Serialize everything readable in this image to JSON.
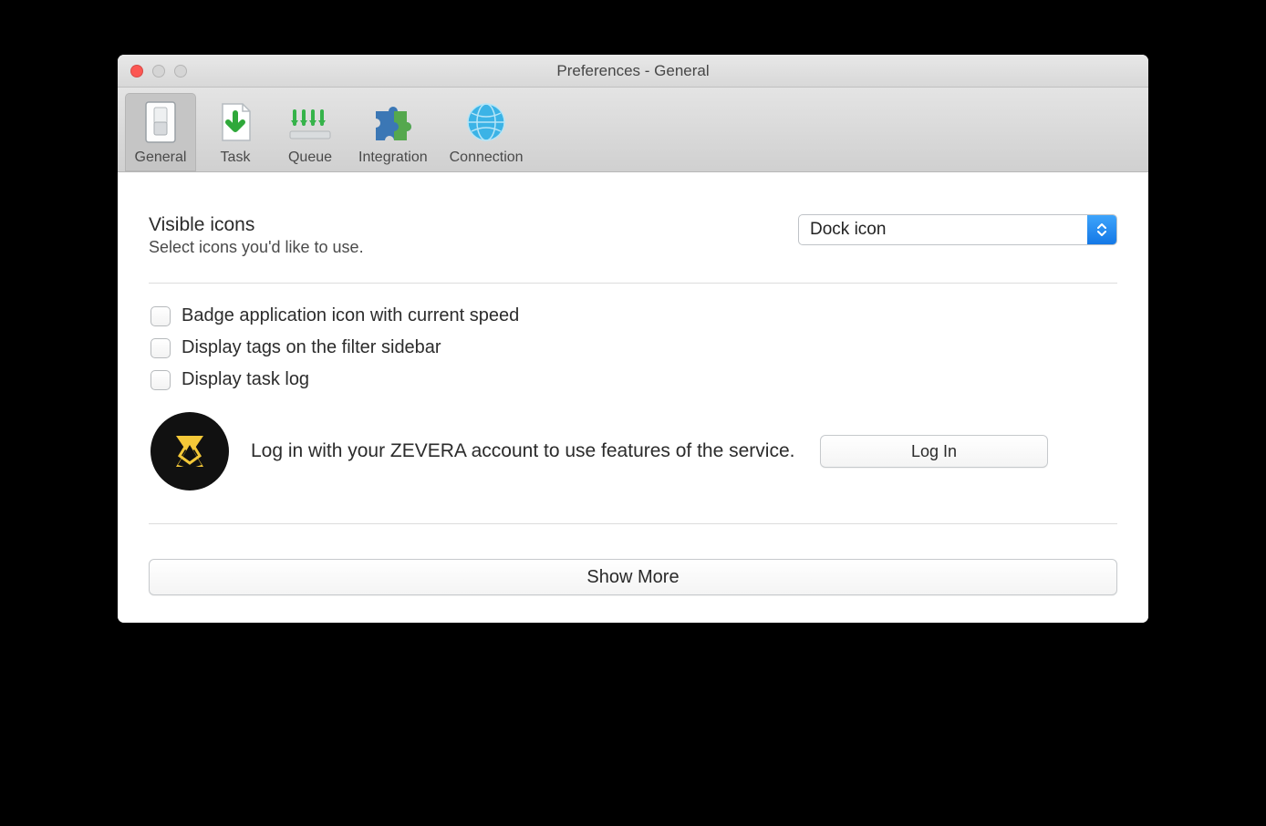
{
  "window": {
    "title": "Preferences - General"
  },
  "toolbar": {
    "tabs": [
      {
        "label": "General"
      },
      {
        "label": "Task"
      },
      {
        "label": "Queue"
      },
      {
        "label": "Integration"
      },
      {
        "label": "Connection"
      }
    ]
  },
  "visible_icons": {
    "title": "Visible icons",
    "subtitle": "Select icons you'd like to use.",
    "selected": "Dock icon"
  },
  "options": {
    "badge_speed": "Badge application icon with current speed",
    "display_tags": "Display tags on the filter sidebar",
    "display_log": "Display task log"
  },
  "account": {
    "text": "Log in with your ZEVERA account to use features of the service.",
    "login_label": "Log In"
  },
  "show_more": {
    "label": "Show More"
  }
}
